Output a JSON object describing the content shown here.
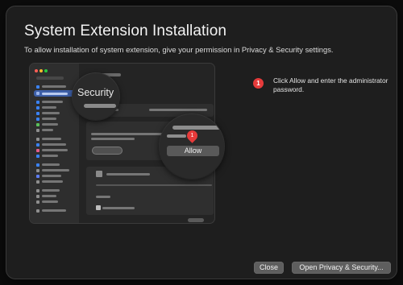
{
  "dialog": {
    "title": "System Extension Installation",
    "subtitle": "To allow installation of system extension, give your permission in Privacy & Security settings."
  },
  "illustration": {
    "security_label": "Security",
    "allow_label": "Allow",
    "marker_number": "1"
  },
  "steps": [
    {
      "number": "1",
      "text": "Click Allow and enter the administrator password."
    }
  ],
  "buttons": {
    "close_label": "Close",
    "open_settings_label": "Open Privacy & Security..."
  },
  "colors": {
    "accent_red": "#e63b3b",
    "dialog_bg": "#1e1e1e",
    "button_bg": "#5e5e5e"
  }
}
